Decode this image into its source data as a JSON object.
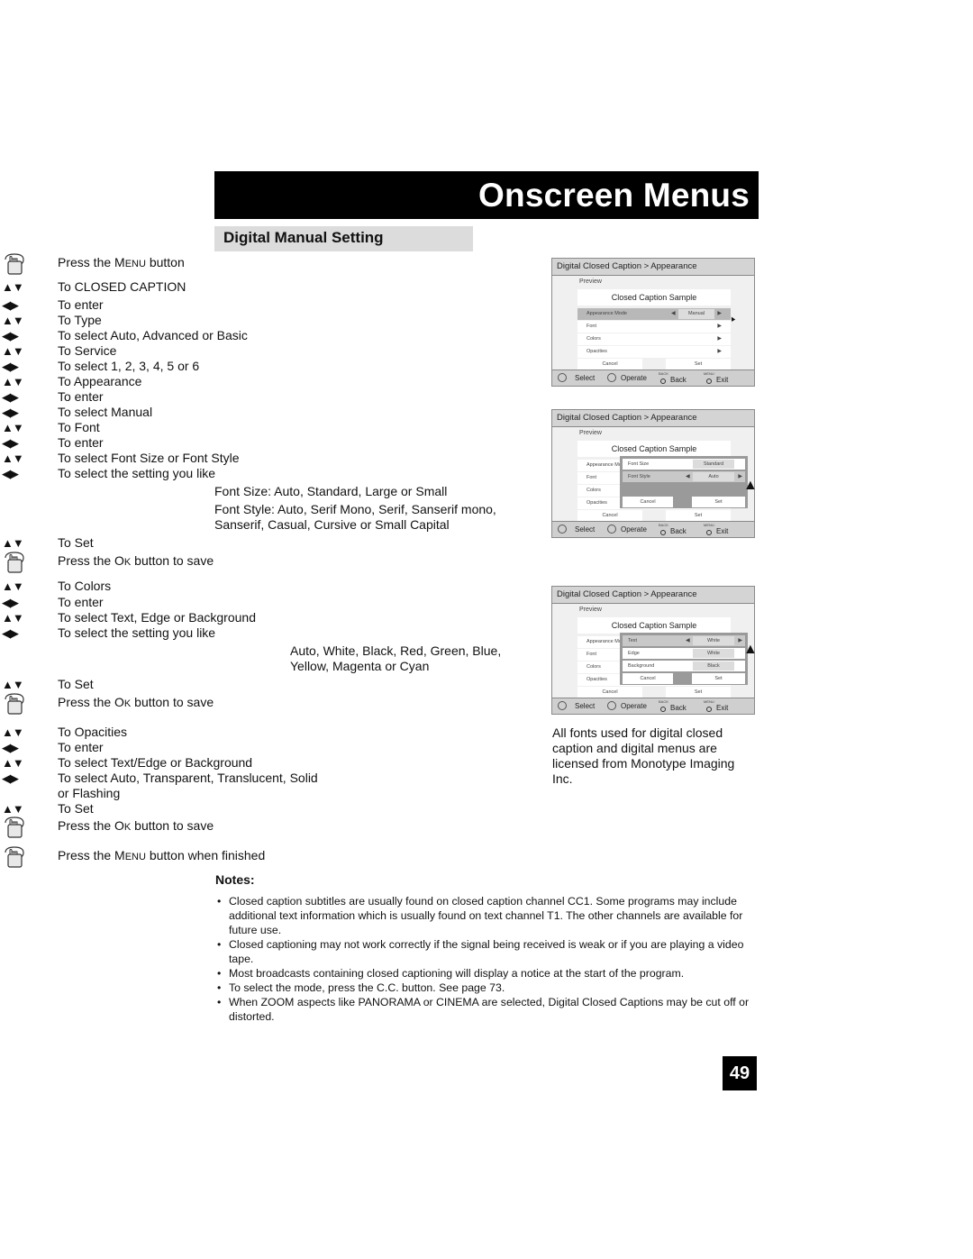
{
  "header": {
    "title": "Onscreen Menus"
  },
  "section": {
    "title": "Digital Manual Setting"
  },
  "steps": [
    {
      "icon": "hand-press-icon",
      "text_pre": "Press the ",
      "key": "Menu",
      "text_post": " button"
    },
    {
      "icon": "up-down-arrows-icon",
      "text": "To CLOSED CAPTION"
    },
    {
      "icon": "left-right-arrows-icon",
      "text": "To enter"
    },
    {
      "icon": "up-down-arrows-icon",
      "text": "To Type"
    },
    {
      "icon": "left-right-arrows-icon",
      "text": "To select Auto, Advanced or Basic"
    },
    {
      "icon": "up-down-arrows-icon",
      "text": "To Service"
    },
    {
      "icon": "left-right-arrows-icon",
      "text": "To select 1, 2, 3, 4, 5 or 6"
    },
    {
      "icon": "up-down-arrows-icon",
      "text": "To Appearance"
    },
    {
      "icon": "left-right-arrows-icon",
      "text": "To enter"
    },
    {
      "icon": "left-right-arrows-icon",
      "text": "To select Manual"
    },
    {
      "icon": "up-down-arrows-icon",
      "text": "To Font"
    },
    {
      "icon": "left-right-arrows-icon",
      "text": "To enter"
    },
    {
      "icon": "up-down-arrows-icon",
      "text": "To select Font Size or Font Style"
    },
    {
      "icon": "left-right-arrows-icon",
      "text": "To select the setting you like"
    },
    {
      "icon": "up-down-arrows-icon",
      "text": "To Set"
    },
    {
      "icon": "hand-press-icon",
      "text_pre": "Press the ",
      "key": "Ok",
      "text_post": " button to save"
    },
    {
      "icon": "up-down-arrows-icon",
      "text": "To Colors"
    },
    {
      "icon": "left-right-arrows-icon",
      "text": "To enter"
    },
    {
      "icon": "up-down-arrows-icon",
      "text": "To select Text, Edge or Background"
    },
    {
      "icon": "left-right-arrows-icon",
      "text": "To select the setting you like"
    },
    {
      "icon": "up-down-arrows-icon",
      "text": "To Set"
    },
    {
      "icon": "hand-press-icon",
      "text_pre": "Press the ",
      "key": "Ok",
      "text_post": " button to save"
    },
    {
      "icon": "up-down-arrows-icon",
      "text": "To Opacities"
    },
    {
      "icon": "left-right-arrows-icon",
      "text": "To enter"
    },
    {
      "icon": "up-down-arrows-icon",
      "text": "To select Text/Edge or Background"
    },
    {
      "icon": "left-right-arrows-icon",
      "text": "To select Auto, Transparent, Translucent, Solid or Flashing"
    },
    {
      "icon": "up-down-arrows-icon",
      "text": "To Set"
    },
    {
      "icon": "hand-press-icon",
      "text_pre": "Press the ",
      "key": "Ok",
      "text_post": " button to save"
    },
    {
      "icon": "hand-press-icon",
      "text_pre": "Press the ",
      "key": "Menu",
      "text_post": " button when finished"
    }
  ],
  "font_size_note": "Font Size: Auto, Standard, Large or Small",
  "font_style_note_1": "Font Style: Auto, Serif Mono, Serif, Sanserif mono,",
  "font_style_note_2": "Sanserif, Casual, Cursive or Small Capital",
  "color_options_1": "Auto, White, Black, Red, Green, Blue,",
  "color_options_2": "Yellow, Magenta or Cyan",
  "panels": [
    {
      "title": "Digital Closed Caption  >  Appearance",
      "preview_label": "Preview",
      "sample": "Closed Caption Sample",
      "rows": [
        {
          "label": "Appearance Mode",
          "value": "Manual",
          "selected": true
        },
        {
          "label": "Font"
        },
        {
          "label": "Colors"
        },
        {
          "label": "Opacities"
        }
      ],
      "cancel": "Cancel",
      "set": "Set",
      "footer": {
        "select": "Select",
        "operate": "Operate",
        "back_key": "BACK",
        "back": "Back",
        "menu_key": "MENU",
        "exit": "Exit"
      }
    },
    {
      "title": "Digital Closed Caption  >  Appearance",
      "preview_label": "Preview",
      "sample": "Closed Caption Sample",
      "rows": [
        {
          "label": "Appearance Mo"
        },
        {
          "label": "Font"
        },
        {
          "label": "Colors"
        },
        {
          "label": "Opacities"
        }
      ],
      "submenu": [
        {
          "label": "Font Size",
          "value": "Standard"
        },
        {
          "label": "Font Style",
          "value": "Auto",
          "selected": true
        }
      ],
      "sub_cancel": "Cancel",
      "sub_set": "Set",
      "cancel": "Cancel",
      "set": "Set",
      "footer": {
        "select": "Select",
        "operate": "Operate",
        "back_key": "BACK",
        "back": "Back",
        "menu_key": "MENU",
        "exit": "Exit"
      }
    },
    {
      "title": "Digital Closed Caption  >  Appearance",
      "preview_label": "Preview",
      "sample": "Closed Caption Sample",
      "rows": [
        {
          "label": "Appearance Mo"
        },
        {
          "label": "Font"
        },
        {
          "label": "Colors"
        },
        {
          "label": "Opacities"
        }
      ],
      "submenu": [
        {
          "label": "Text",
          "value": "White",
          "selected": true
        },
        {
          "label": "Edge",
          "value": "White"
        },
        {
          "label": "Background",
          "value": "Black"
        }
      ],
      "sub_cancel": "Cancel",
      "sub_set": "Set",
      "cancel": "Cancel",
      "set": "Set",
      "footer": {
        "select": "Select",
        "operate": "Operate",
        "back_key": "BACK",
        "back": "Back",
        "menu_key": "MENU",
        "exit": "Exit"
      }
    }
  ],
  "license_text": "All fonts used for digital closed caption and digital menus are licensed from Monotype Imaging Inc.",
  "notes": {
    "title": "Notes:",
    "items": [
      "Closed caption subtitles are usually found on closed caption channel CC1. Some programs may include additional text information which is usually found on text channel T1. The other channels are available for future use.",
      "Closed captioning may not work correctly if the signal being received is weak or if you are playing a video tape.",
      "Most broadcasts containing closed captioning will display a notice at the start of the program.",
      "To select the mode, press the C.C. button. See page 73.",
      "When ZOOM aspects like PANORAMA or CINEMA are selected, Digital Closed Captions may be cut off or distorted."
    ]
  },
  "page_number": "49"
}
